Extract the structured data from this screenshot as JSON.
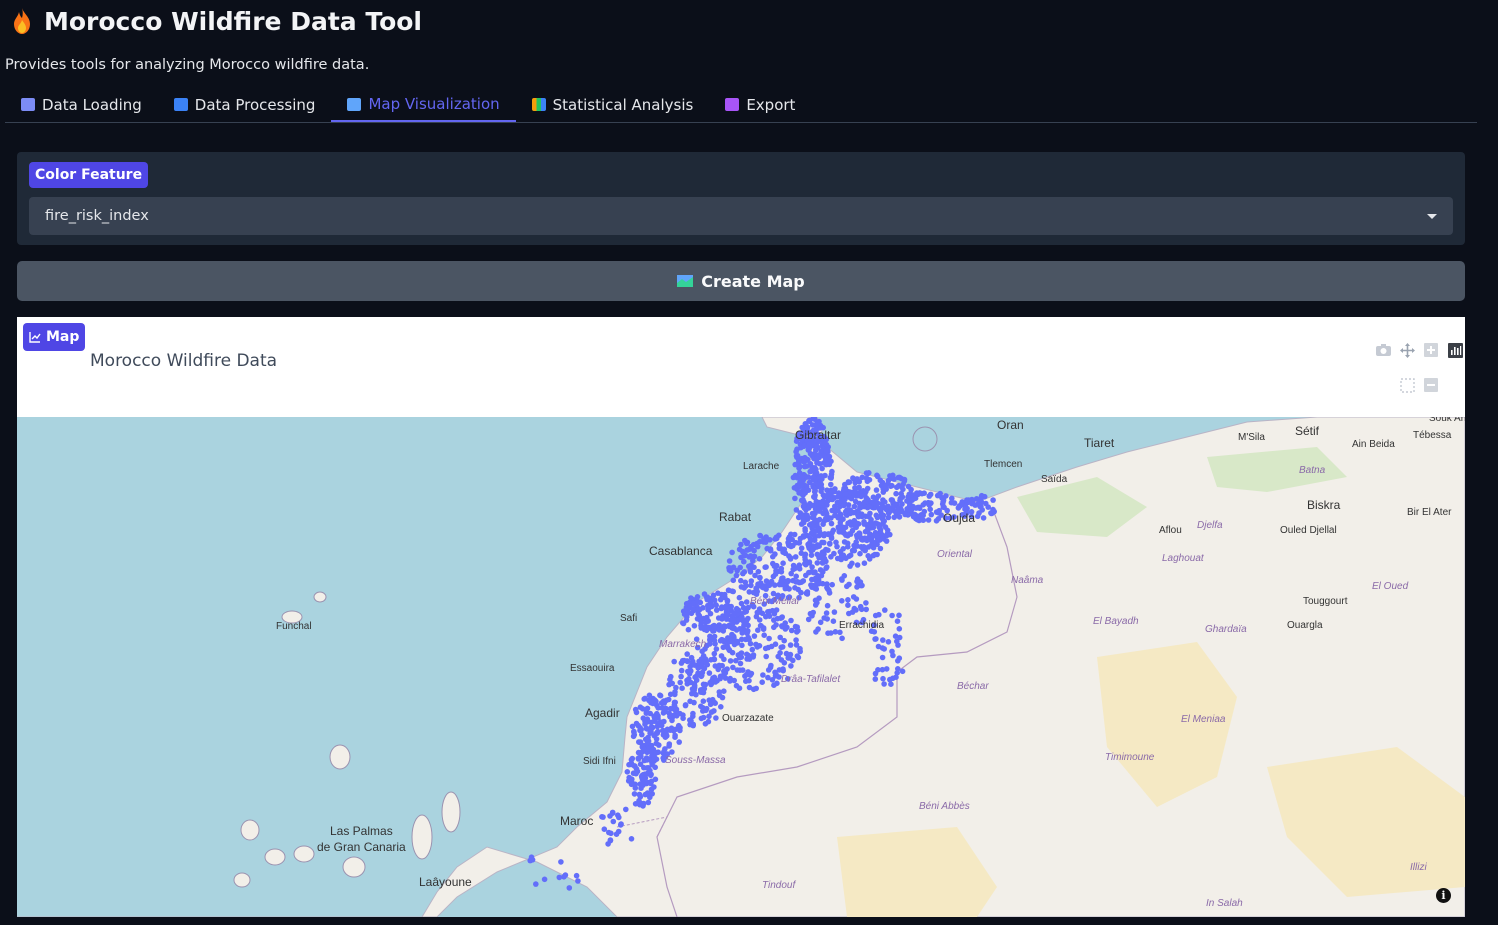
{
  "app": {
    "title": "Morocco Wildfire Data Tool",
    "subtitle": "Provides tools for analyzing Morocco wildfire data.",
    "title_icon": "fire-icon"
  },
  "tabs": [
    {
      "label": "Data Loading",
      "icon": "inbox-icon",
      "color": "#7c8cf5",
      "active": false
    },
    {
      "label": "Data Processing",
      "icon": "refresh-icon",
      "color": "#3b82f6",
      "active": false
    },
    {
      "label": "Map Visualization",
      "icon": "map-icon",
      "color": "#60a5fa",
      "active": true
    },
    {
      "label": "Statistical Analysis",
      "icon": "bar-chart-icon",
      "color": "#f59e0b",
      "active": false
    },
    {
      "label": "Export",
      "icon": "floppy-disk-icon",
      "color": "#a855f7",
      "active": false
    }
  ],
  "color_feature": {
    "label": "Color Feature",
    "selected": "fire_risk_index"
  },
  "create_map": {
    "label": "Create Map",
    "icon": "map-icon"
  },
  "map": {
    "badge": "Map",
    "badge_icon": "chart-icon",
    "plot_title": "Morocco Wildfire Data",
    "modebar": [
      "camera-icon",
      "pan-icon",
      "zoom-in-icon",
      "plotly-logo-icon",
      "box-select-icon",
      "zoom-out-icon"
    ],
    "point_color": "#636efa",
    "sea_color": "#aad3df",
    "land_color": "#f2efe9",
    "place_labels": [
      "Gibraltar",
      "Larache",
      "Rabat",
      "Casablanca",
      "Safi",
      "Essaouira",
      "Agadir",
      "Sidi Ifni",
      "Maroc",
      "Laâyoune",
      "Funchal",
      "Las Palmas",
      "de Gran Canaria",
      "Oran",
      "Tiaret",
      "Tlemcen",
      "Saïda",
      "Oujda",
      "Oriental",
      "Naâma",
      "Errachidia",
      "Drâa-Tafilalet",
      "Ouarzazate",
      "Souss-Massa",
      "Béchar",
      "Béni Abbès",
      "Tindouf",
      "El Bayadh",
      "Laghouat",
      "Djelfa",
      "Aflou",
      "Ghardaïa",
      "Ouargla",
      "El Meniaa",
      "Timimoune",
      "Biskra",
      "Touggourt",
      "Ouled Djellal",
      "El Oued",
      "Bir El Ater",
      "Tébessa",
      "Batna",
      "M'Sila",
      "Sétif",
      "Ain Beida",
      "In Salah",
      "Illizi",
      "Béni Mellal",
      "Marrakech",
      "Souk Ah"
    ]
  }
}
